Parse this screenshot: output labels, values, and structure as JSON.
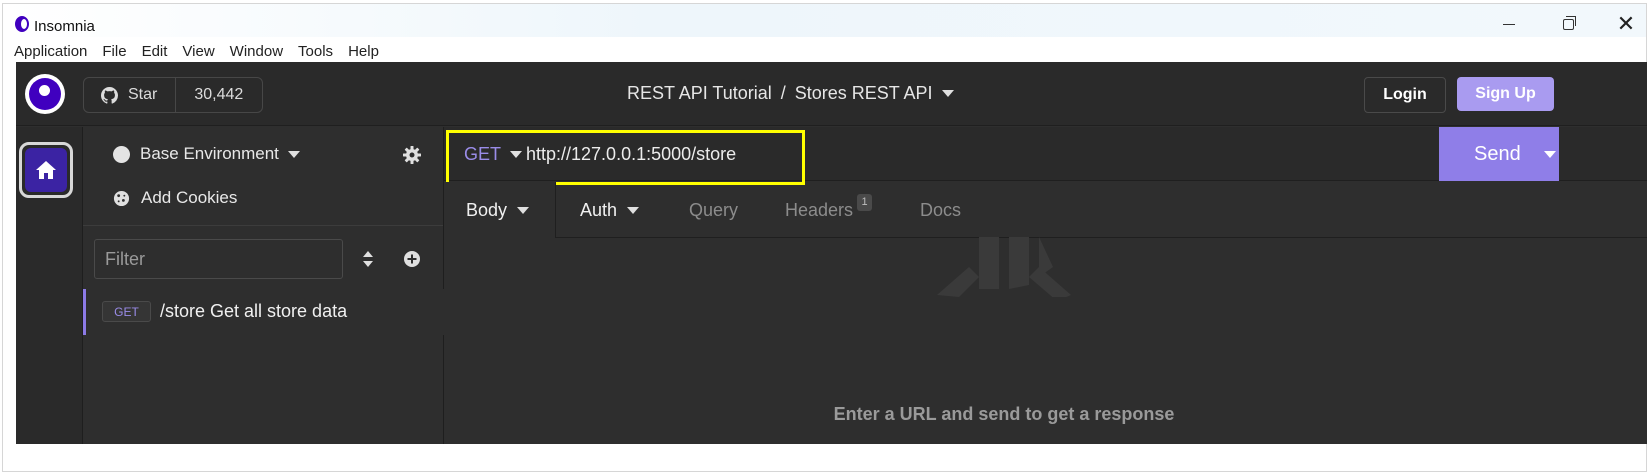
{
  "window": {
    "title": "Insomnia",
    "controls": [
      "minimize",
      "maximize",
      "close"
    ]
  },
  "menubar": {
    "items": [
      "Application",
      "File",
      "Edit",
      "View",
      "Window",
      "Tools",
      "Help"
    ]
  },
  "header": {
    "star_label": "Star",
    "star_count": "30,442",
    "breadcrumb": {
      "project": "REST API Tutorial",
      "separator": "/",
      "collection": "Stores REST API"
    },
    "login_label": "Login",
    "signup_label": "Sign Up"
  },
  "sidebar": {
    "environment_label": "Base Environment",
    "cookies_label": "Add Cookies",
    "filter": {
      "value": "",
      "placeholder": "Filter"
    },
    "requests": [
      {
        "method": "GET",
        "name": "/store Get all store data"
      }
    ]
  },
  "request": {
    "method": "GET",
    "url": "http://127.0.0.1:5000/store",
    "send_label": "Send",
    "tabs": [
      {
        "label": "Body",
        "has_dropdown": true,
        "active": true
      },
      {
        "label": "Auth",
        "has_dropdown": true,
        "active": false
      },
      {
        "label": "Query",
        "has_dropdown": false,
        "active": false
      },
      {
        "label": "Headers",
        "has_dropdown": false,
        "active": false,
        "count": "1"
      },
      {
        "label": "Docs",
        "has_dropdown": false,
        "active": false
      }
    ],
    "empty_message": "Enter a URL and send to get a response"
  },
  "colors": {
    "accent": "#8f7ee8",
    "signup_button": "#a99bf0",
    "brand": "#4000bf",
    "highlight_box": "#ffff00",
    "app_background": "#2e2e2e"
  },
  "icons": {
    "app": "insomnia-logo-icon",
    "github": "github-icon",
    "home": "home-icon",
    "settings": "gear-icon",
    "cookies": "cookie-icon",
    "sort": "sort-icon",
    "add": "plus-circle-icon",
    "dropdown": "caret-down-icon"
  }
}
